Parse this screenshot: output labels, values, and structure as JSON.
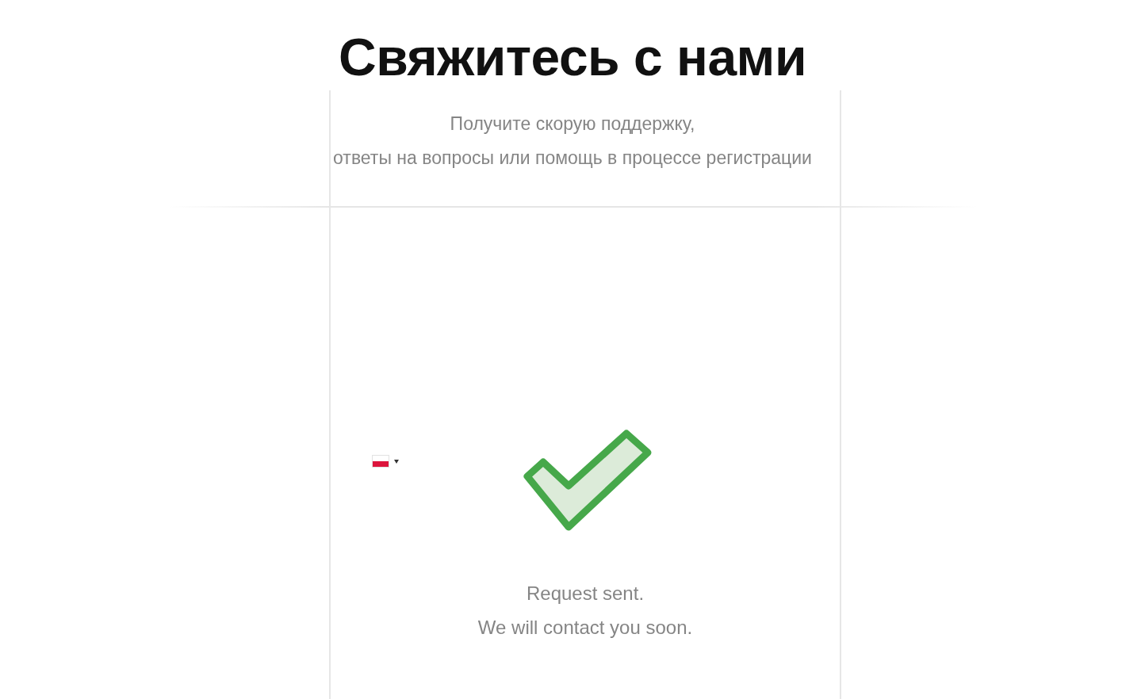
{
  "heading": "Свяжитесь с нами",
  "subtitle": [
    "Получите скорую поддержку,",
    "ответы на вопросы или помощь в процессе регистрации"
  ],
  "confirmation": {
    "lines": [
      "Request sent.",
      "We will contact you soon."
    ]
  }
}
